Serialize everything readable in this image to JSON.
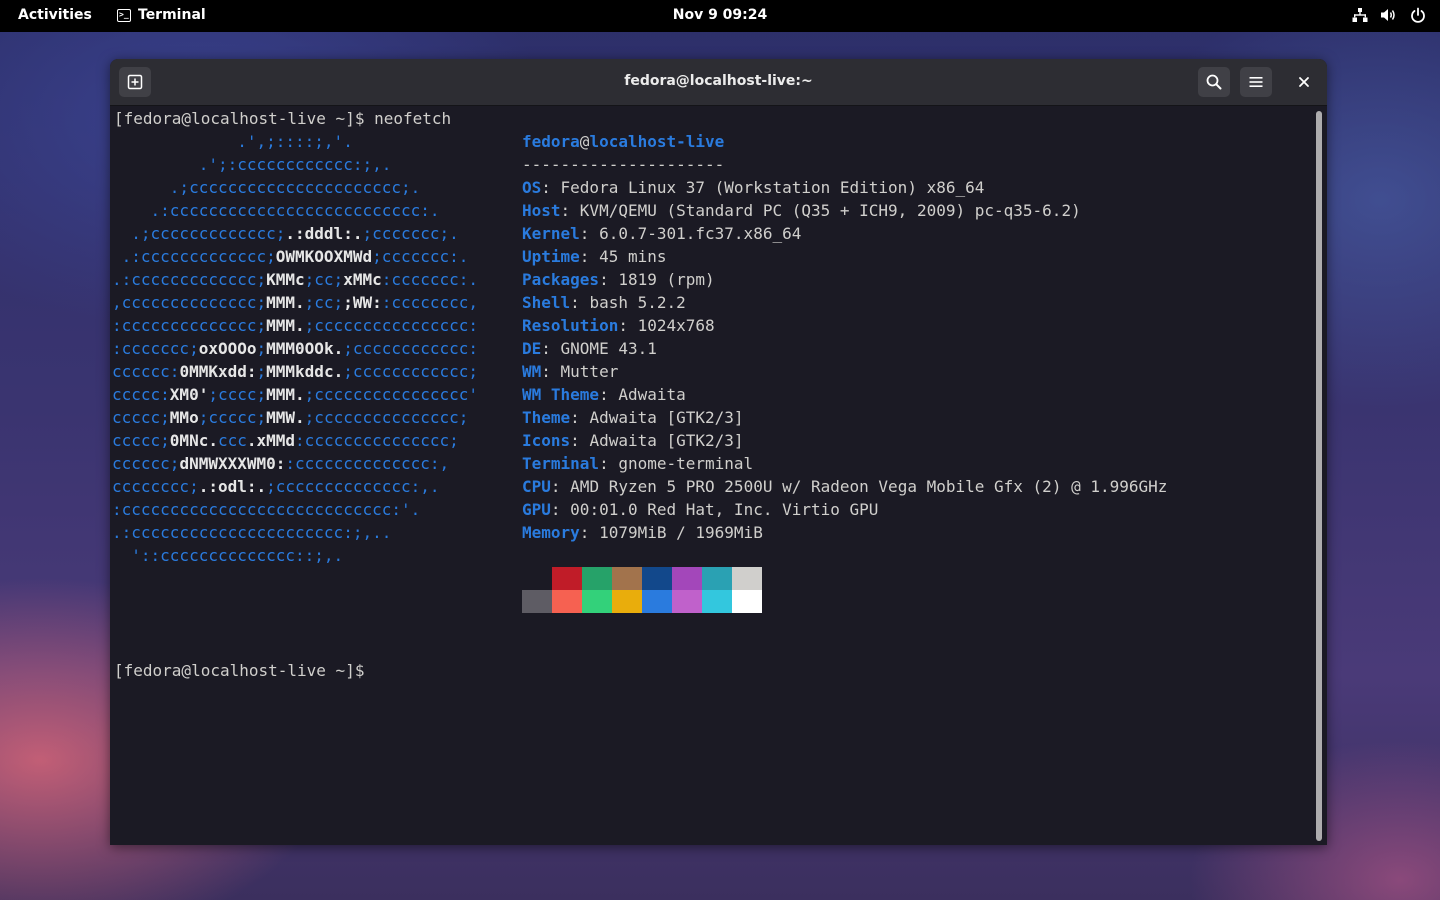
{
  "topbar": {
    "activities": "Activities",
    "app_name": "Terminal",
    "clock": "Nov 9  09:24",
    "icons": [
      "network-icon",
      "volume-icon",
      "power-icon"
    ]
  },
  "window": {
    "title": "fedora@localhost-live:~",
    "icons": [
      "new-tab-icon",
      "search-icon",
      "hamburger-menu-icon",
      "close-icon"
    ]
  },
  "terminal": {
    "prompt1": "[fedora@localhost-live ~]$ neofetch",
    "prompt2": "[fedora@localhost-live ~]$",
    "logo": [
      [
        [
          "b",
          "             .',;::::;,'."
        ]
      ],
      [
        [
          "b",
          "         .';:cccccccccccc:;,."
        ]
      ],
      [
        [
          "b",
          "      .;cccccccccccccccccccccc;."
        ]
      ],
      [
        [
          "b",
          "    .:cccccccccccccccccccccccccc:."
        ]
      ],
      [
        [
          "b",
          "  .;ccccccccccccc;"
        ],
        [
          "w",
          ".:dddl:."
        ],
        [
          "b",
          ";ccccccc;."
        ]
      ],
      [
        [
          "b",
          " .:ccccccccccccc;"
        ],
        [
          "w",
          "OWMKOOXMWd"
        ],
        [
          "b",
          ";ccccccc:."
        ]
      ],
      [
        [
          "b",
          ".:ccccccccccccc;"
        ],
        [
          "w",
          "KMMc"
        ],
        [
          "b",
          ";cc;"
        ],
        [
          "w",
          "xMMc"
        ],
        [
          "b",
          ":ccccccc:."
        ]
      ],
      [
        [
          "b",
          ",cccccccccccccc;"
        ],
        [
          "w",
          "MMM."
        ],
        [
          "b",
          ";cc;"
        ],
        [
          "w",
          ";WW:"
        ],
        [
          "b",
          ":cccccccc,"
        ]
      ],
      [
        [
          "b",
          ":cccccccccccccc;"
        ],
        [
          "w",
          "MMM."
        ],
        [
          "b",
          ";cccccccccccccccc:"
        ]
      ],
      [
        [
          "b",
          ":ccccccc;"
        ],
        [
          "w",
          "oxOOOo"
        ],
        [
          "b",
          ";"
        ],
        [
          "w",
          "MMM0OOk."
        ],
        [
          "b",
          ";cccccccccccc:"
        ]
      ],
      [
        [
          "b",
          "cccccc:"
        ],
        [
          "w",
          "0MMKxdd:"
        ],
        [
          "b",
          ";"
        ],
        [
          "w",
          "MMMkddc."
        ],
        [
          "b",
          ";cccccccccccc;"
        ]
      ],
      [
        [
          "b",
          "ccccc:"
        ],
        [
          "w",
          "XM0'"
        ],
        [
          "b",
          ";cccc;"
        ],
        [
          "w",
          "MMM."
        ],
        [
          "b",
          ";cccccccccccccccc'"
        ]
      ],
      [
        [
          "b",
          "ccccc;"
        ],
        [
          "w",
          "MMo"
        ],
        [
          "b",
          ";ccccc;"
        ],
        [
          "w",
          "MMW."
        ],
        [
          "b",
          ";ccccccccccccccc;"
        ]
      ],
      [
        [
          "b",
          "ccccc;"
        ],
        [
          "w",
          "0MNc."
        ],
        [
          "b",
          "ccc"
        ],
        [
          "w",
          ".xMMd"
        ],
        [
          "b",
          ":ccccccccccccccc;"
        ]
      ],
      [
        [
          "b",
          "cccccc;"
        ],
        [
          "w",
          "dNMWXXXWM0:"
        ],
        [
          "b",
          ":cccccccccccccc:,"
        ]
      ],
      [
        [
          "b",
          "cccccccc;"
        ],
        [
          "w",
          ".:odl:."
        ],
        [
          "b",
          ";cccccccccccccc:,."
        ]
      ],
      [
        [
          "b",
          ":cccccccccccccccccccccccccccc:'."
        ]
      ],
      [
        [
          "b",
          ".:cccccccccccccccccccccc:;,.."
        ]
      ],
      [
        [
          "b",
          "  '::cccccccccccccc::;,."
        ]
      ]
    ],
    "user": "fedora",
    "at": "@",
    "host": "localhost-live",
    "separator": "---------------------",
    "info": [
      {
        "key": "OS",
        "value": "Fedora Linux 37 (Workstation Edition) x86_64"
      },
      {
        "key": "Host",
        "value": "KVM/QEMU (Standard PC (Q35 + ICH9, 2009) pc-q35-6.2)"
      },
      {
        "key": "Kernel",
        "value": "6.0.7-301.fc37.x86_64"
      },
      {
        "key": "Uptime",
        "value": "45 mins"
      },
      {
        "key": "Packages",
        "value": "1819 (rpm)"
      },
      {
        "key": "Shell",
        "value": "bash 5.2.2"
      },
      {
        "key": "Resolution",
        "value": "1024x768"
      },
      {
        "key": "DE",
        "value": "GNOME 43.1"
      },
      {
        "key": "WM",
        "value": "Mutter"
      },
      {
        "key": "WM Theme",
        "value": "Adwaita"
      },
      {
        "key": "Theme",
        "value": "Adwaita [GTK2/3]"
      },
      {
        "key": "Icons",
        "value": "Adwaita [GTK2/3]"
      },
      {
        "key": "Terminal",
        "value": "gnome-terminal"
      },
      {
        "key": "CPU",
        "value": "AMD Ryzen 5 PRO 2500U w/ Radeon Vega Mobile Gfx (2) @ 1.996GHz"
      },
      {
        "key": "GPU",
        "value": "00:01.0 Red Hat, Inc. Virtio GPU"
      },
      {
        "key": "Memory",
        "value": "1079MiB / 1969MiB"
      }
    ],
    "palette_row1": [
      "#1b1a24",
      "#c01c28",
      "#26a269",
      "#a2734c",
      "#12488b",
      "#a347ba",
      "#2aa1b3",
      "#d0cfcc"
    ],
    "palette_row2": [
      "#5e5c64",
      "#f66151",
      "#33d17a",
      "#e9ad0c",
      "#2a7bde",
      "#c061cb",
      "#33c7de",
      "#ffffff"
    ]
  }
}
